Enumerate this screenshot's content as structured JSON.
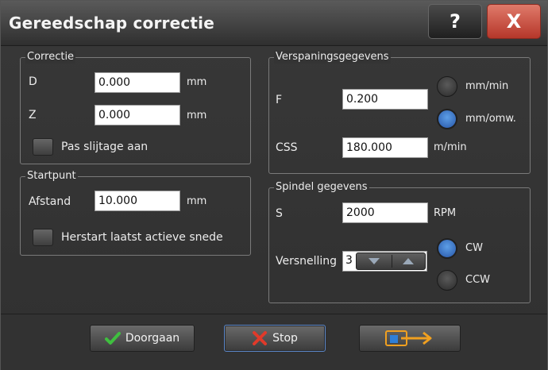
{
  "dialog": {
    "title": "Gereedschap correctie",
    "help_label": "?",
    "close_label": "X"
  },
  "correctie": {
    "legend": "Correctie",
    "d_label": "D",
    "d_value": "0.000",
    "d_unit": "mm",
    "z_label": "Z",
    "z_value": "0.000",
    "z_unit": "mm",
    "wear_label": "Pas slijtage aan"
  },
  "startpunt": {
    "legend": "Startpunt",
    "afstand_label": "Afstand",
    "afstand_value": "10.000",
    "afstand_unit": "mm",
    "restart_label": "Herstart laatst actieve snede"
  },
  "verspaning": {
    "legend": "Verspaningsgegevens",
    "f_label": "F",
    "f_value": "0.200",
    "radio_mm_min": "mm/min",
    "radio_mm_omw": "mm/omw.",
    "selected_feed_unit": "mm/omw.",
    "css_label": "CSS",
    "css_value": "180.000",
    "css_unit": "m/min"
  },
  "spindel": {
    "legend": "Spindel gegevens",
    "s_label": "S",
    "s_value": "2000",
    "s_unit": "RPM",
    "gear_label": "Versnelling",
    "gear_value": "3",
    "radio_cw": "CW",
    "radio_ccw": "CCW",
    "selected_direction": "CW"
  },
  "footer": {
    "continue_label": "Doorgaan",
    "stop_label": "Stop"
  },
  "icons": {
    "help": "question-mark-icon",
    "close": "close-x-icon",
    "continue": "green-check-icon",
    "stop": "red-x-icon",
    "exit": "machine-exit-icon"
  },
  "colors": {
    "accent_radio": "#3f7fd0",
    "close_button": "#c9483a",
    "check_green": "#3fbf3f",
    "stop_red": "#e03a2a",
    "exit_orange": "#f0a020"
  }
}
